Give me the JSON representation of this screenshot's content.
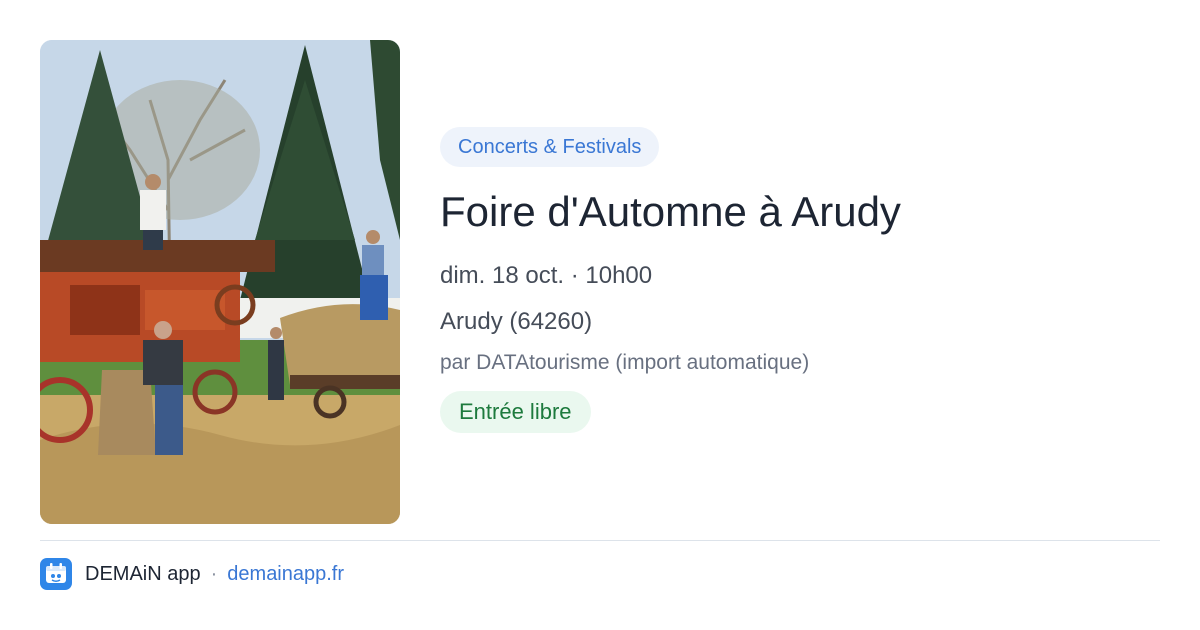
{
  "event": {
    "category": "Concerts & Festivals",
    "title": "Foire d'Automne à Arudy",
    "date": "dim. 18 oct. · 10h00",
    "location": "Arudy (64260)",
    "source": "par DATAtourisme (import automatique)",
    "price": "Entrée libre"
  },
  "footer": {
    "app_name": "DEMAiN app",
    "separator": "·",
    "url": "demainapp.fr"
  },
  "colors": {
    "accent": "#3a77d4",
    "price_green": "#1d7a3d",
    "logo_blue": "#2f86e8"
  },
  "icons": {
    "app_logo": "demain-app-icon"
  }
}
